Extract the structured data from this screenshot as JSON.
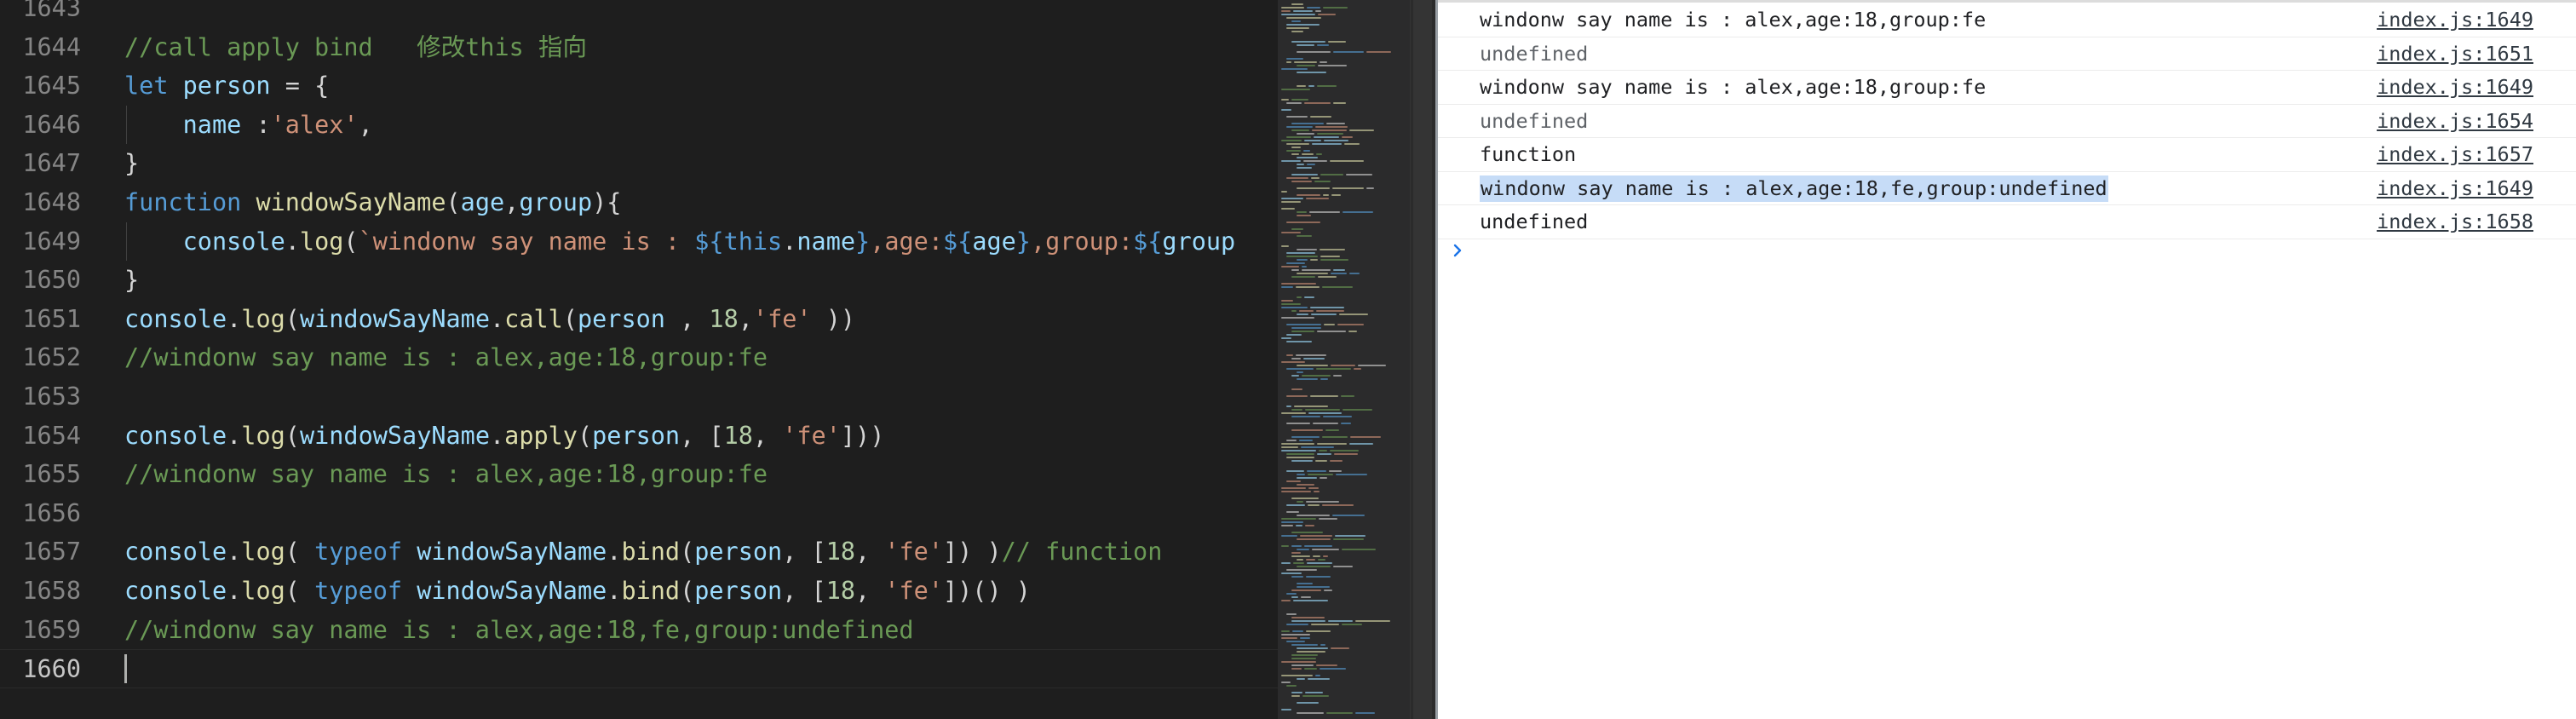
{
  "editor": {
    "lines": [
      {
        "num": "1643",
        "tokens": []
      },
      {
        "num": "1644",
        "tokens": [
          {
            "t": "//call apply bind   修改this 指向",
            "c": "comment"
          }
        ]
      },
      {
        "num": "1645",
        "tokens": [
          {
            "t": "let ",
            "c": "keyword"
          },
          {
            "t": "person",
            "c": "var"
          },
          {
            "t": " = {",
            "c": "punc"
          }
        ]
      },
      {
        "num": "1646",
        "tokens": [
          {
            "t": "    ",
            "c": "punc"
          },
          {
            "t": "name",
            "c": "var"
          },
          {
            "t": " :",
            "c": "punc"
          },
          {
            "t": "'alex'",
            "c": "string"
          },
          {
            "t": ",",
            "c": "punc"
          }
        ]
      },
      {
        "num": "1647",
        "tokens": [
          {
            "t": "}",
            "c": "punc"
          }
        ]
      },
      {
        "num": "1648",
        "tokens": [
          {
            "t": "function ",
            "c": "keyword"
          },
          {
            "t": "windowSayName",
            "c": "func"
          },
          {
            "t": "(",
            "c": "punc"
          },
          {
            "t": "age",
            "c": "var"
          },
          {
            "t": ",",
            "c": "punc"
          },
          {
            "t": "group",
            "c": "var"
          },
          {
            "t": "){",
            "c": "punc"
          }
        ]
      },
      {
        "num": "1649",
        "tokens": [
          {
            "t": "    ",
            "c": "punc"
          },
          {
            "t": "console",
            "c": "var"
          },
          {
            "t": ".",
            "c": "punc"
          },
          {
            "t": "log",
            "c": "func"
          },
          {
            "t": "(",
            "c": "punc"
          },
          {
            "t": "`windonw say name is : ",
            "c": "string"
          },
          {
            "t": "${",
            "c": "keyword"
          },
          {
            "t": "this",
            "c": "keyword"
          },
          {
            "t": ".",
            "c": "punc"
          },
          {
            "t": "name",
            "c": "var"
          },
          {
            "t": "}",
            "c": "keyword"
          },
          {
            "t": ",age:",
            "c": "string"
          },
          {
            "t": "${",
            "c": "keyword"
          },
          {
            "t": "age",
            "c": "var"
          },
          {
            "t": "}",
            "c": "keyword"
          },
          {
            "t": ",group:",
            "c": "string"
          },
          {
            "t": "${",
            "c": "keyword"
          },
          {
            "t": "group",
            "c": "var"
          }
        ]
      },
      {
        "num": "1650",
        "tokens": [
          {
            "t": "}",
            "c": "punc"
          }
        ]
      },
      {
        "num": "1651",
        "tokens": [
          {
            "t": "console",
            "c": "var"
          },
          {
            "t": ".",
            "c": "punc"
          },
          {
            "t": "log",
            "c": "func"
          },
          {
            "t": "(",
            "c": "punc"
          },
          {
            "t": "windowSayName",
            "c": "var"
          },
          {
            "t": ".",
            "c": "punc"
          },
          {
            "t": "call",
            "c": "func"
          },
          {
            "t": "(",
            "c": "punc"
          },
          {
            "t": "person",
            "c": "var"
          },
          {
            "t": " , ",
            "c": "punc"
          },
          {
            "t": "18",
            "c": "number"
          },
          {
            "t": ",",
            "c": "punc"
          },
          {
            "t": "'fe'",
            "c": "string"
          },
          {
            "t": " ))",
            "c": "punc"
          }
        ]
      },
      {
        "num": "1652",
        "tokens": [
          {
            "t": "//windonw say name is : alex,age:18,group:fe",
            "c": "comment"
          }
        ]
      },
      {
        "num": "1653",
        "tokens": []
      },
      {
        "num": "1654",
        "tokens": [
          {
            "t": "console",
            "c": "var"
          },
          {
            "t": ".",
            "c": "punc"
          },
          {
            "t": "log",
            "c": "func"
          },
          {
            "t": "(",
            "c": "punc"
          },
          {
            "t": "windowSayName",
            "c": "var"
          },
          {
            "t": ".",
            "c": "punc"
          },
          {
            "t": "apply",
            "c": "func"
          },
          {
            "t": "(",
            "c": "punc"
          },
          {
            "t": "person",
            "c": "var"
          },
          {
            "t": ", [",
            "c": "punc"
          },
          {
            "t": "18",
            "c": "number"
          },
          {
            "t": ", ",
            "c": "punc"
          },
          {
            "t": "'fe'",
            "c": "string"
          },
          {
            "t": "]))",
            "c": "punc"
          }
        ]
      },
      {
        "num": "1655",
        "tokens": [
          {
            "t": "//windonw say name is : alex,age:18,group:fe",
            "c": "comment"
          }
        ]
      },
      {
        "num": "1656",
        "tokens": []
      },
      {
        "num": "1657",
        "tokens": [
          {
            "t": "console",
            "c": "var"
          },
          {
            "t": ".",
            "c": "punc"
          },
          {
            "t": "log",
            "c": "func"
          },
          {
            "t": "( ",
            "c": "punc"
          },
          {
            "t": "typeof ",
            "c": "keyword"
          },
          {
            "t": "windowSayName",
            "c": "var"
          },
          {
            "t": ".",
            "c": "punc"
          },
          {
            "t": "bind",
            "c": "func"
          },
          {
            "t": "(",
            "c": "punc"
          },
          {
            "t": "person",
            "c": "var"
          },
          {
            "t": ", [",
            "c": "punc"
          },
          {
            "t": "18",
            "c": "number"
          },
          {
            "t": ", ",
            "c": "punc"
          },
          {
            "t": "'fe'",
            "c": "string"
          },
          {
            "t": "]) )",
            "c": "punc"
          },
          {
            "t": "// function",
            "c": "comment"
          }
        ]
      },
      {
        "num": "1658",
        "tokens": [
          {
            "t": "console",
            "c": "var"
          },
          {
            "t": ".",
            "c": "punc"
          },
          {
            "t": "log",
            "c": "func"
          },
          {
            "t": "( ",
            "c": "punc"
          },
          {
            "t": "typeof ",
            "c": "keyword"
          },
          {
            "t": "windowSayName",
            "c": "var"
          },
          {
            "t": ".",
            "c": "punc"
          },
          {
            "t": "bind",
            "c": "func"
          },
          {
            "t": "(",
            "c": "punc"
          },
          {
            "t": "person",
            "c": "var"
          },
          {
            "t": ", [",
            "c": "punc"
          },
          {
            "t": "18",
            "c": "number"
          },
          {
            "t": ", ",
            "c": "punc"
          },
          {
            "t": "'fe'",
            "c": "string"
          },
          {
            "t": "])() )",
            "c": "punc"
          }
        ]
      },
      {
        "num": "1659",
        "tokens": [
          {
            "t": "//windonw say name is : alex,age:18,fe,group:undefined",
            "c": "comment"
          }
        ]
      },
      {
        "num": "1660",
        "tokens": [],
        "current": true
      }
    ]
  },
  "console": {
    "rows": [
      {
        "message": "windonw say name is : alex,age:18,group:fe",
        "source": "index.js:1649",
        "muted": false,
        "highlighted": false
      },
      {
        "message": "undefined",
        "source": "index.js:1651",
        "muted": true,
        "highlighted": false
      },
      {
        "message": "windonw say name is : alex,age:18,group:fe",
        "source": "index.js:1649",
        "muted": false,
        "highlighted": false
      },
      {
        "message": "undefined",
        "source": "index.js:1654",
        "muted": true,
        "highlighted": false
      },
      {
        "message": "function",
        "source": "index.js:1657",
        "muted": false,
        "highlighted": false
      },
      {
        "message": "windonw say name is : alex,age:18,fe,group:undefined",
        "source": "index.js:1649",
        "muted": false,
        "highlighted": true
      },
      {
        "message": "undefined",
        "source": "index.js:1658",
        "muted": false,
        "highlighted": false
      }
    ],
    "prompt_icon": "chevron-right-icon"
  },
  "colors": {
    "editor_bg": "#1e1e1e",
    "comment": "#6a9955",
    "keyword": "#569cd6",
    "variable": "#9cdcfe",
    "function": "#dcdcaa",
    "string": "#ce9178",
    "number": "#b5cea8",
    "console_highlight": "#c6dcf7",
    "prompt": "#1a73e8"
  }
}
